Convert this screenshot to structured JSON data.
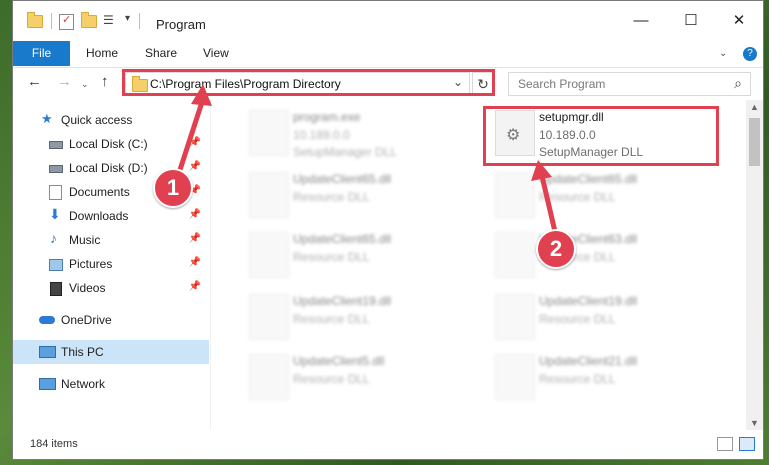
{
  "window": {
    "title": "Program",
    "controls": {
      "minimize": "—",
      "maximize": "☐",
      "close": "✕"
    }
  },
  "ribbon": {
    "tabs": [
      "File",
      "Home",
      "Share",
      "View"
    ],
    "help_icon": "?"
  },
  "nav": {
    "back": "←",
    "forward": "→",
    "up": "↑"
  },
  "address": {
    "path": "C:\\Program Files\\Program Directory",
    "dropdown": "⌄",
    "refresh": "↻"
  },
  "search": {
    "placeholder": "Search Program",
    "icon": "⌕"
  },
  "sidebar": {
    "items": [
      {
        "label": "Quick access",
        "icon": "star-icon",
        "pinned": false
      },
      {
        "label": "Local Disk (C:)",
        "icon": "drive-icon",
        "pinned": true
      },
      {
        "label": "Local Disk (D:)",
        "icon": "drive-icon",
        "pinned": true
      },
      {
        "label": "Documents",
        "icon": "documents-icon",
        "pinned": true
      },
      {
        "label": "Downloads",
        "icon": "downloads-icon",
        "pinned": true
      },
      {
        "label": "Music",
        "icon": "music-icon",
        "pinned": true
      },
      {
        "label": "Pictures",
        "icon": "pictures-icon",
        "pinned": true
      },
      {
        "label": "Videos",
        "icon": "videos-icon",
        "pinned": true
      },
      {
        "label": "OneDrive",
        "icon": "cloud-icon",
        "pinned": false
      },
      {
        "label": "This PC",
        "icon": "computer-icon",
        "pinned": false,
        "selected": true
      },
      {
        "label": "Network",
        "icon": "network-icon",
        "pinned": false
      }
    ]
  },
  "files": [
    {
      "name": "program.exe",
      "line2": "10.189.0.0",
      "line3": "SetupManager DLL",
      "blurred": true
    },
    {
      "name": "setupmgr.dll",
      "line2": "10.189.0.0",
      "line3": "SetupManager DLL",
      "blurred": false,
      "highlighted": true
    },
    {
      "name": "UpdateClient65.dll",
      "line2": "Resource DLL",
      "line3": "",
      "blurred": true
    },
    {
      "name": "UpdateClient65.dll",
      "line2": "Resource DLL",
      "line3": "",
      "blurred": true
    },
    {
      "name": "UpdateClient65.dll",
      "line2": "Resource DLL",
      "line3": "",
      "blurred": true
    },
    {
      "name": "UpdateClient63.dll",
      "line2": "Resource DLL",
      "line3": "",
      "blurred": true
    },
    {
      "name": "UpdateClient19.dll",
      "line2": "Resource DLL",
      "line3": "",
      "blurred": true
    },
    {
      "name": "UpdateClient19.dll",
      "line2": "Resource DLL",
      "line3": "",
      "blurred": true
    },
    {
      "name": "UpdateClient5.dll",
      "line2": "Resource DLL",
      "line3": "",
      "blurred": true
    },
    {
      "name": "UpdateClient21.dll",
      "line2": "Resource DLL",
      "line3": "",
      "blurred": true
    }
  ],
  "status": {
    "item_count": "184 items"
  },
  "annotations": {
    "step1": "1",
    "step2": "2"
  },
  "colors": {
    "accent": "#1979ca",
    "highlight": "#e0404f",
    "selection": "#cce4f7"
  }
}
